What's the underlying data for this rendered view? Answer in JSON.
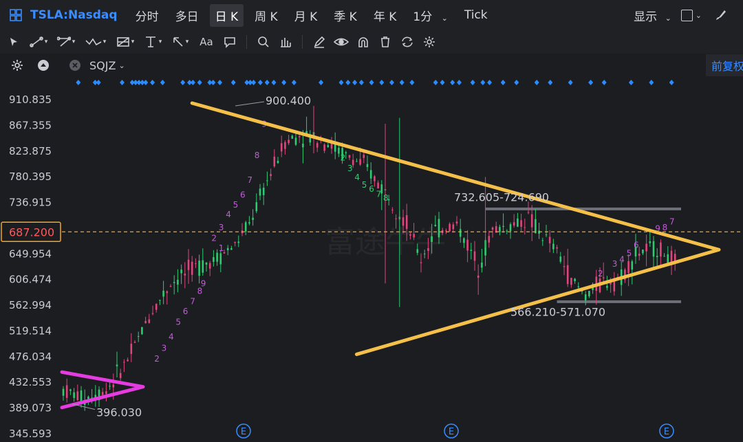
{
  "header": {
    "symbol": "TSLA:Nasdaq",
    "tabs": [
      {
        "label": "分时",
        "active": false
      },
      {
        "label": "多日",
        "active": false
      },
      {
        "label": "日 K",
        "active": true
      },
      {
        "label": "周 K",
        "active": false
      },
      {
        "label": "月 K",
        "active": false
      },
      {
        "label": "季 K",
        "active": false
      },
      {
        "label": "年 K",
        "active": false
      },
      {
        "label": "1分",
        "active": false
      },
      {
        "label": "Tick",
        "active": false
      }
    ],
    "display_label": "显示"
  },
  "toolbar": {
    "text_tool_label": "Aa",
    "tools": [
      "cursor-icon",
      "trendline-icon",
      "polyline-icon",
      "wave-icon",
      "fib-icon",
      "horizontal-line-icon",
      "arrow-icon",
      "text-icon",
      "note-icon",
      "zoom-icon",
      "measure-icon",
      "pencil-icon",
      "eye-icon",
      "magnet-icon",
      "trash-icon",
      "sync-icon",
      "gear-icon"
    ]
  },
  "indicator_bar": {
    "indicator_name": "SQJZ",
    "adjust_label": "前复权"
  },
  "colors": {
    "up": "#e0457b",
    "down": "#2ecc71",
    "triangle_main": "#f5c04a",
    "triangle_small": "#e43ce0",
    "last_price": "#f5a623",
    "level_line": "#6d7079",
    "signal_dot": "#2b8cff"
  },
  "chart_data": {
    "type": "candlestick",
    "y_ticks": [
      "910.835",
      "867.355",
      "823.875",
      "780.395",
      "736.915",
      "687.200",
      "649.954",
      "606.474",
      "562.994",
      "519.514",
      "476.034",
      "432.553",
      "389.073",
      "345.593"
    ],
    "ylim": [
      345.593,
      910.835
    ],
    "last_price": 687.2,
    "annotations": [
      {
        "text": "900.400",
        "price": 900.4
      },
      {
        "text": "396.030",
        "price": 396.03
      },
      {
        "text": "732.605-724.690",
        "price": 728.6
      },
      {
        "text": "566.210-571.070",
        "price": 568.6
      }
    ],
    "level_bands": [
      {
        "price": 726.0,
        "from_bar": 118,
        "to_bar": 173
      },
      {
        "price": 569.0,
        "from_bar": 138,
        "to_bar": 173
      }
    ],
    "td_labels": [
      "9",
      "8",
      "7",
      "6",
      "5",
      "4",
      "3",
      "2",
      "9",
      "8",
      "7",
      "6",
      "5",
      "4",
      "3",
      "2",
      "1",
      "2",
      "3",
      "4",
      "5",
      "6",
      "7",
      "8",
      "9",
      "8",
      "7",
      "6",
      "5",
      "4",
      "3",
      "2"
    ],
    "earnings_markers": [
      "E",
      "E",
      "E"
    ],
    "watermark": "富途牛牛"
  }
}
